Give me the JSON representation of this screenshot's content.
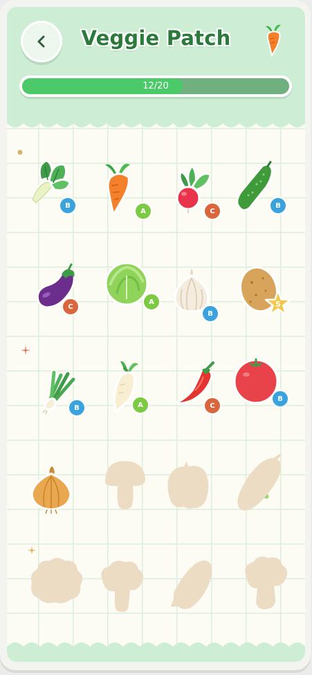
{
  "header": {
    "title": "Veggie Patch",
    "back_icon": "chevron-left-icon",
    "mascot_icon": "carrot-icon"
  },
  "progress": {
    "label": "12/20",
    "collected": 12,
    "total": 20,
    "fill_color": "#4cca6a",
    "track_color": "#6fb07e"
  },
  "colors": {
    "header_bg": "#cdeed4",
    "title": "#2b7a3c",
    "rarity_A": "#7cc943",
    "rarity_B": "#3aa3de",
    "rarity_C": "#d9663d",
    "rarity_S": "#f3c84a",
    "locked_silhouette": "#ecdcc3"
  },
  "collection": [
    {
      "icon": "bok-choy-icon",
      "rarity": "B",
      "unlocked": true
    },
    {
      "icon": "carrot-icon",
      "rarity": "A",
      "unlocked": true
    },
    {
      "icon": "radish-icon",
      "rarity": "C",
      "unlocked": true
    },
    {
      "icon": "cucumber-icon",
      "rarity": "B",
      "unlocked": true
    },
    {
      "icon": "eggplant-icon",
      "rarity": "C",
      "unlocked": true
    },
    {
      "icon": "cabbage-icon",
      "rarity": "A",
      "unlocked": true
    },
    {
      "icon": "garlic-icon",
      "rarity": "B",
      "unlocked": true
    },
    {
      "icon": "potato-icon",
      "rarity": "S",
      "unlocked": true
    },
    {
      "icon": "scallion-icon",
      "rarity": "B",
      "unlocked": true
    },
    {
      "icon": "daikon-icon",
      "rarity": "A",
      "unlocked": true
    },
    {
      "icon": "chili-pepper-icon",
      "rarity": "C",
      "unlocked": true
    },
    {
      "icon": "tomato-icon",
      "rarity": "B",
      "unlocked": true
    },
    {
      "icon": "onion-icon",
      "rarity": "",
      "unlocked": true
    },
    {
      "icon": "mushroom-silhouette-icon",
      "rarity": "",
      "unlocked": false
    },
    {
      "icon": "bell-pepper-silhouette-icon",
      "rarity": "",
      "unlocked": false
    },
    {
      "icon": "sweet-potato-silhouette-icon",
      "rarity": "",
      "unlocked": false
    },
    {
      "icon": "cauliflower-silhouette-icon",
      "rarity": "",
      "unlocked": false
    },
    {
      "icon": "broccoli-silhouette-icon",
      "rarity": "",
      "unlocked": false
    },
    {
      "icon": "corn-silhouette-icon",
      "rarity": "",
      "unlocked": false
    },
    {
      "icon": "broccoli-silhouette-icon",
      "rarity": "",
      "unlocked": false
    }
  ]
}
